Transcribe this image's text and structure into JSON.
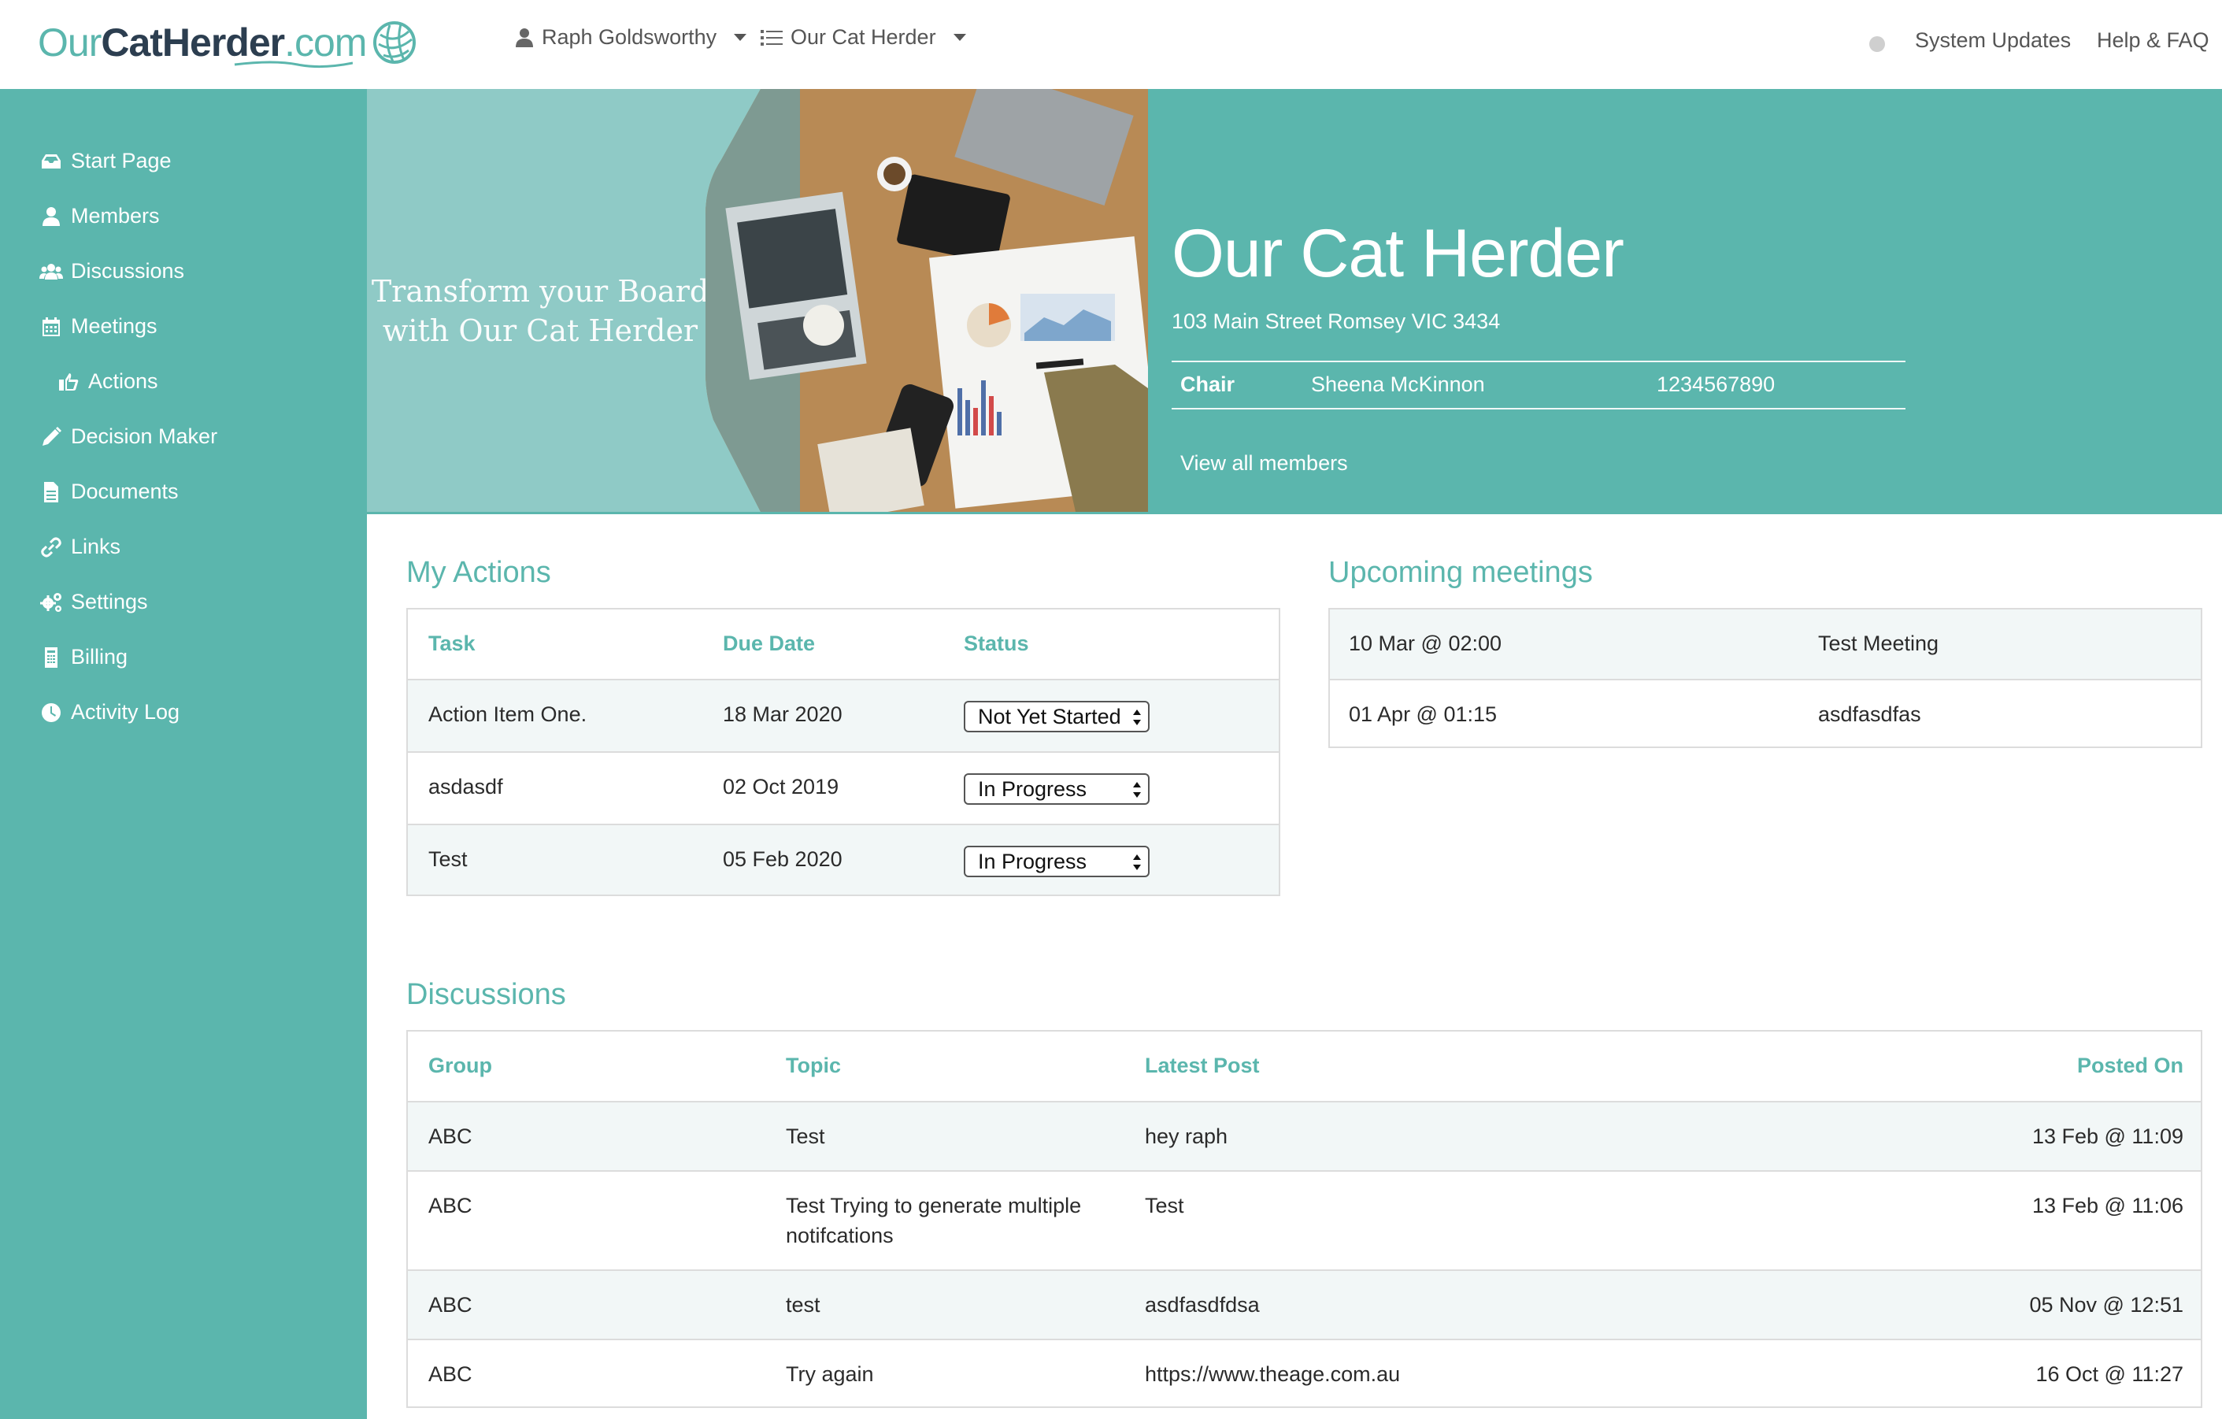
{
  "header": {
    "logo": {
      "our": "Our",
      "cat": "CatHerder",
      "com": ".com"
    },
    "user_menu": "Raph Goldsworthy",
    "org_menu": "Our Cat Herder",
    "links": [
      "System Updates",
      "Help & FAQ"
    ]
  },
  "sidebar": {
    "items": [
      {
        "label": "Start Page",
        "icon": "inbox-icon"
      },
      {
        "label": "Members",
        "icon": "user-icon"
      },
      {
        "label": "Discussions",
        "icon": "users-icon"
      },
      {
        "label": "Meetings",
        "icon": "calendar-icon"
      },
      {
        "label": "Actions",
        "icon": "hand-point-icon"
      },
      {
        "label": "Decision Maker",
        "icon": "pencil-icon"
      },
      {
        "label": "Documents",
        "icon": "file-icon"
      },
      {
        "label": "Links",
        "icon": "link-icon"
      },
      {
        "label": "Settings",
        "icon": "gears-icon"
      },
      {
        "label": "Billing",
        "icon": "billing-icon"
      },
      {
        "label": "Activity Log",
        "icon": "clock-icon"
      }
    ]
  },
  "hero": {
    "tagline": "Transform your Board with Our Cat Herder",
    "title": "Our Cat Herder",
    "address": "103 Main Street Romsey VIC 3434",
    "chair_label": "Chair",
    "chair_name": "Sheena McKinnon",
    "chair_phone": "1234567890",
    "view_members": "View all members"
  },
  "my_actions": {
    "title": "My Actions",
    "columns": [
      "Task",
      "Due Date",
      "Status"
    ],
    "rows": [
      {
        "task": "Action Item One.",
        "due": "18 Mar 2020",
        "status": "Not Yet Started"
      },
      {
        "task": "asdasdf",
        "due": "02 Oct 2019",
        "status": "In Progress"
      },
      {
        "task": "Test",
        "due": "05 Feb 2020",
        "status": "In Progress"
      }
    ]
  },
  "meetings": {
    "title": "Upcoming meetings",
    "rows": [
      {
        "when": "10 Mar @ 02:00",
        "name": "Test Meeting"
      },
      {
        "when": "01 Apr @ 01:15",
        "name": "asdfasdfas"
      }
    ]
  },
  "discussions": {
    "title": "Discussions",
    "columns": [
      "Group",
      "Topic",
      "Latest Post",
      "Posted On"
    ],
    "rows": [
      {
        "group": "ABC",
        "topic": "Test",
        "latest": "hey raph",
        "posted": "13 Feb @ 11:09"
      },
      {
        "group": "ABC",
        "topic": "Test Trying to generate multiple notifcations",
        "latest": "Test",
        "posted": "13 Feb @ 11:06"
      },
      {
        "group": "ABC",
        "topic": "test",
        "latest": "asdfasdfdsa",
        "posted": "05 Nov @ 12:51"
      },
      {
        "group": "ABC",
        "topic": "Try again",
        "latest": "https://www.theage.com.au",
        "posted": "16 Oct @ 11:27"
      }
    ]
  }
}
